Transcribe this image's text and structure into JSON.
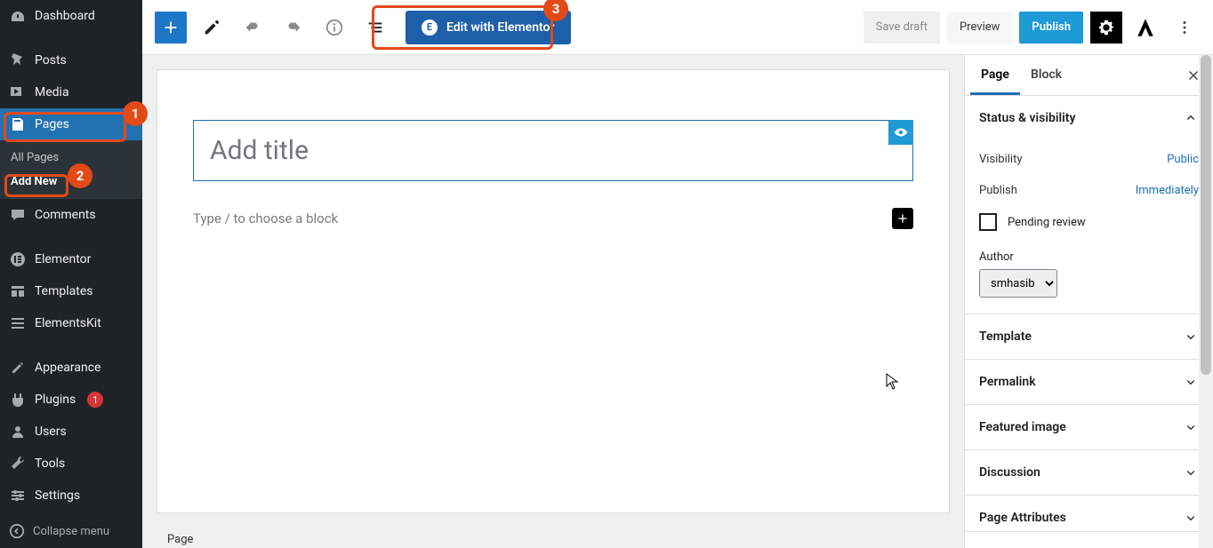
{
  "sidebar": {
    "items": [
      {
        "label": "Dashboard"
      },
      {
        "label": "Posts"
      },
      {
        "label": "Media"
      },
      {
        "label": "Pages"
      },
      {
        "label": "Comments"
      },
      {
        "label": "Elementor"
      },
      {
        "label": "Templates"
      },
      {
        "label": "ElementsKit"
      },
      {
        "label": "Appearance"
      },
      {
        "label": "Plugins"
      },
      {
        "label": "Users"
      },
      {
        "label": "Tools"
      },
      {
        "label": "Settings"
      }
    ],
    "submenu": {
      "all": "All Pages",
      "add": "Add New"
    },
    "plugins_updates": "1",
    "collapse": "Collapse menu"
  },
  "annotations": {
    "one": "1",
    "two": "2",
    "three": "3"
  },
  "topbar": {
    "elementor": "Edit with Elementor",
    "save_draft": "Save draft",
    "preview": "Preview",
    "publish": "Publish"
  },
  "editor": {
    "title_placeholder": "Add title",
    "body_placeholder": "Type / to choose a block",
    "footer_label": "Page"
  },
  "panel": {
    "tabs": {
      "page": "Page",
      "block": "Block"
    },
    "status_heading": "Status & visibility",
    "visibility_label": "Visibility",
    "visibility_value": "Public",
    "publish_label": "Publish",
    "publish_value": "Immediately",
    "pending_label": "Pending review",
    "author_label": "Author",
    "author_value": "smhasib",
    "sections": [
      "Template",
      "Permalink",
      "Featured image",
      "Discussion",
      "Page Attributes"
    ]
  }
}
